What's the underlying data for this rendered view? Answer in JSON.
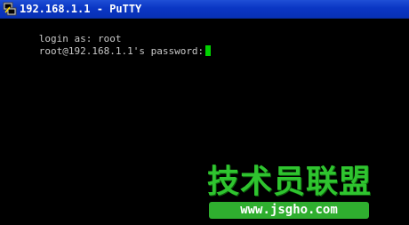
{
  "window": {
    "title": "192.168.1.1 - PuTTY",
    "app_icon": "putty-icon"
  },
  "terminal": {
    "line1": "login as: root",
    "line2": "root@192.168.1.1's password:",
    "cursor_color": "#00d000",
    "text_color": "#c8c8c8",
    "background_color": "#000000"
  },
  "watermark": {
    "title": "技术员联盟",
    "url": "www.jsgho.com",
    "color": "#2fc42f"
  },
  "colors": {
    "titlebar": "#0a36c4"
  }
}
